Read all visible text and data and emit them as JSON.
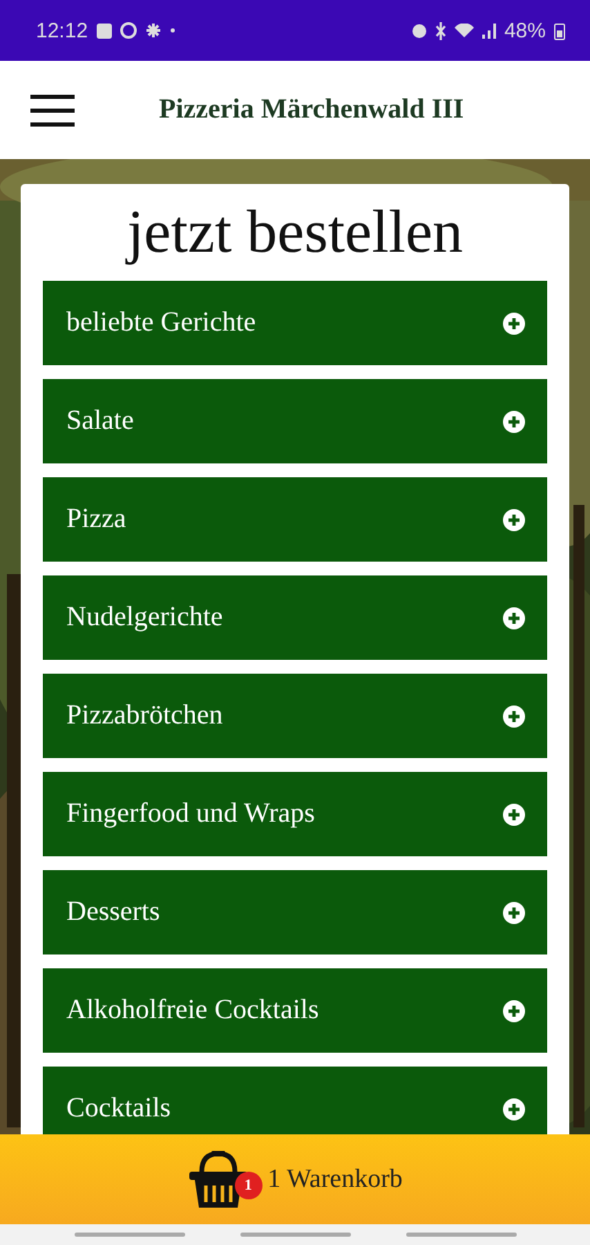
{
  "status_bar": {
    "time": "12:12",
    "battery": "48%"
  },
  "header": {
    "title": "Pizzeria Märchenwald III"
  },
  "order": {
    "title": "jetzt bestellen",
    "categories": [
      {
        "label": "beliebte Gerichte"
      },
      {
        "label": "Salate"
      },
      {
        "label": "Pizza"
      },
      {
        "label": "Nudelgerichte"
      },
      {
        "label": "Pizzabrötchen"
      },
      {
        "label": "Fingerfood und Wraps"
      },
      {
        "label": "Desserts"
      },
      {
        "label": "Alkoholfreie Cocktails"
      },
      {
        "label": "Cocktails"
      }
    ]
  },
  "cart": {
    "badge": "1",
    "label": "1 Warenkorb"
  }
}
